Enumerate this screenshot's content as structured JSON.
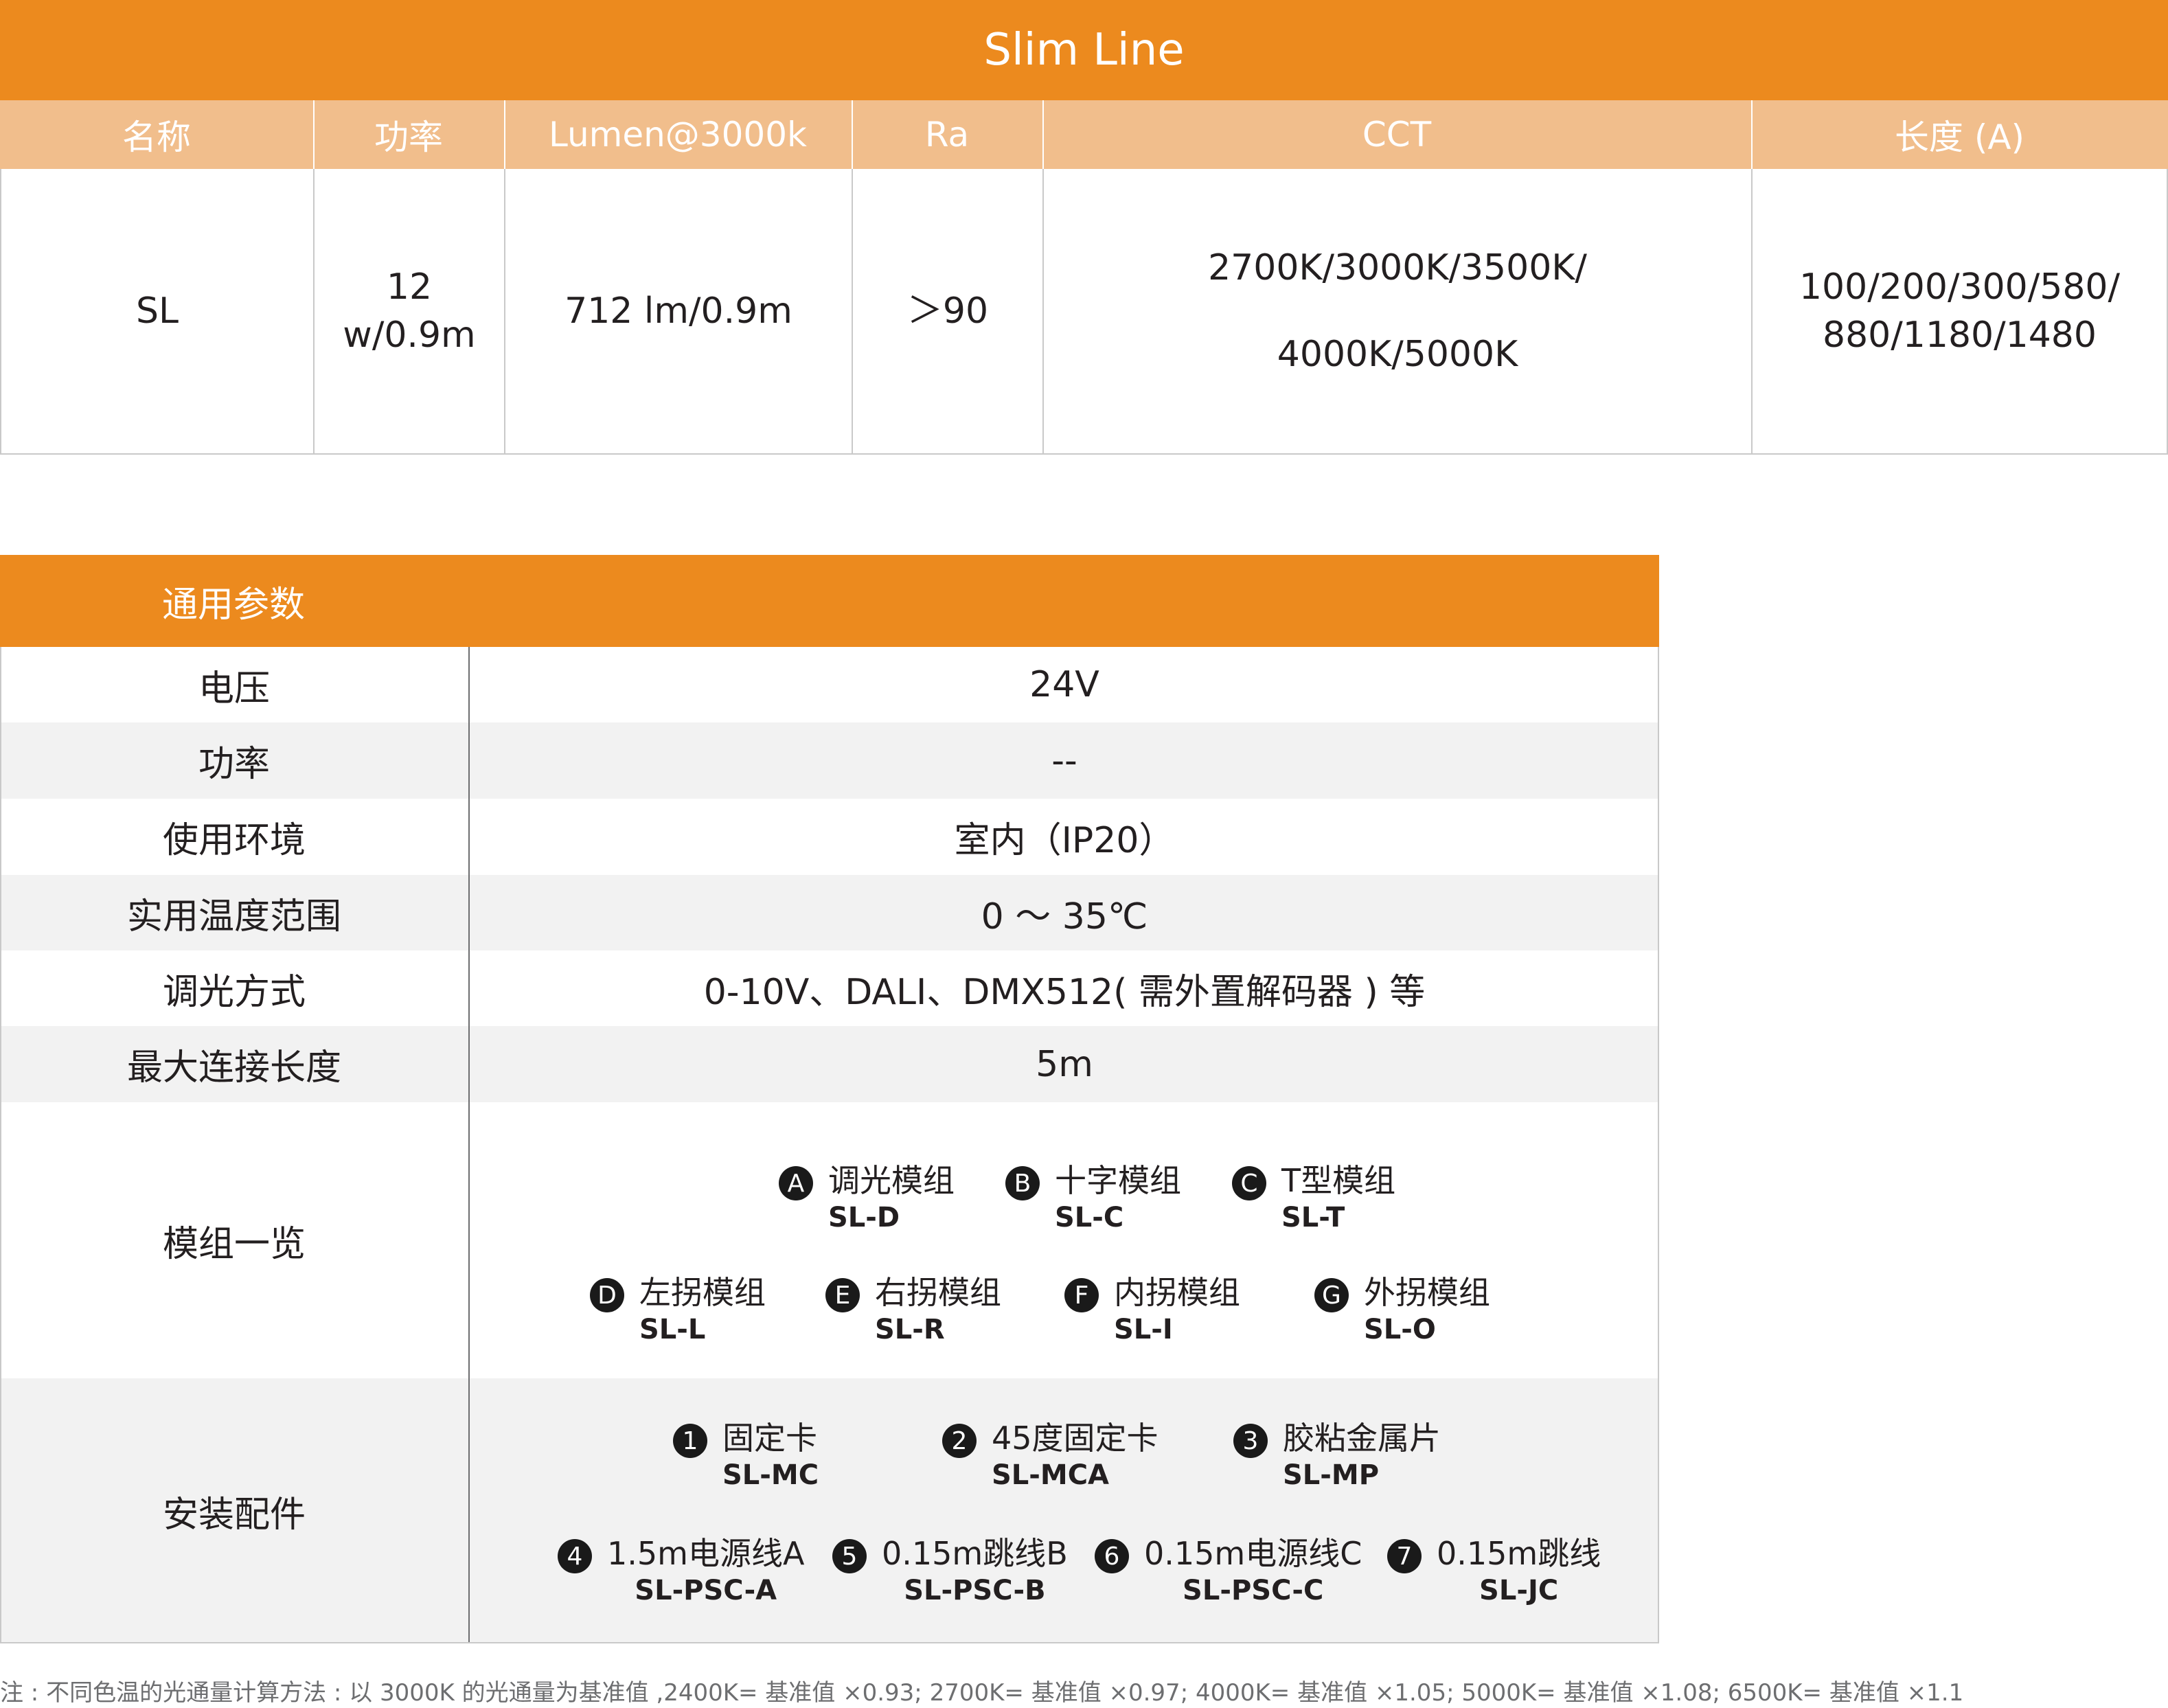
{
  "product_table": {
    "title": "Slim Line",
    "headers": [
      "名称",
      "功率",
      "Lumen@3000k",
      "Ra",
      "CCT",
      "长度 (A)"
    ],
    "row": {
      "name": "SL",
      "power": "12 w/0.9m",
      "lumen": "712 lm/0.9m",
      "ra": "＞90",
      "cct_line1": "2700K/3000K/3500K/",
      "cct_line2": "4000K/5000K",
      "length_line1": "100/200/300/580/",
      "length_line2": "880/1180/1480"
    }
  },
  "params": {
    "title": "通用参数",
    "rows": [
      {
        "label": "电压",
        "value": "24V"
      },
      {
        "label": "功率",
        "value": "--"
      },
      {
        "label": "使用环境",
        "value": "室内（IP20）"
      },
      {
        "label": "实用温度范围",
        "value": "0 ～ 35℃"
      },
      {
        "label": "调光方式",
        "value": "0-10V、DALI、DMX512( 需外置解码器 ) 等"
      },
      {
        "label": "最大连接长度",
        "value": "5m"
      }
    ],
    "modules_label": "模组一览",
    "modules": [
      {
        "badge": "A",
        "name": "调光模组",
        "code": "SL-D"
      },
      {
        "badge": "B",
        "name": "十字模组",
        "code": "SL-C"
      },
      {
        "badge": "C",
        "name": "T型模组",
        "code": "SL-T"
      },
      {
        "badge": "D",
        "name": "左拐模组",
        "code": "SL-L"
      },
      {
        "badge": "E",
        "name": "右拐模组",
        "code": "SL-R"
      },
      {
        "badge": "F",
        "name": "内拐模组",
        "code": "SL-I"
      },
      {
        "badge": "G",
        "name": "外拐模组",
        "code": "SL-O"
      }
    ],
    "accessories_label": "安装配件",
    "accessories": [
      {
        "badge": "1",
        "name": "固定卡",
        "code": "SL-MC"
      },
      {
        "badge": "2",
        "name": "45度固定卡",
        "code": "SL-MCA"
      },
      {
        "badge": "3",
        "name": "胶粘金属片",
        "code": "SL-MP"
      },
      {
        "badge": "4",
        "name": "1.5m电源线A",
        "code": "SL-PSC-A"
      },
      {
        "badge": "5",
        "name": "0.15m跳线B",
        "code": "SL-PSC-B"
      },
      {
        "badge": "6",
        "name": "0.15m电源线C",
        "code": "SL-PSC-C"
      },
      {
        "badge": "7",
        "name": "0.15m跳线",
        "code": "SL-JC"
      }
    ]
  },
  "footnote": "注 : 不同色温的光通量计算方法 : 以 3000K 的光通量为基准值 ,2400K= 基准值 ×0.93; 2700K= 基准值 ×0.97; 4000K= 基准值 ×1.05; 5000K= 基准值 ×1.08; 6500K= 基准值 ×1.1",
  "colors": {
    "accent": "#ec8a1e",
    "header_light": "#f1be8c",
    "row_alt": "#f2f2f2"
  }
}
